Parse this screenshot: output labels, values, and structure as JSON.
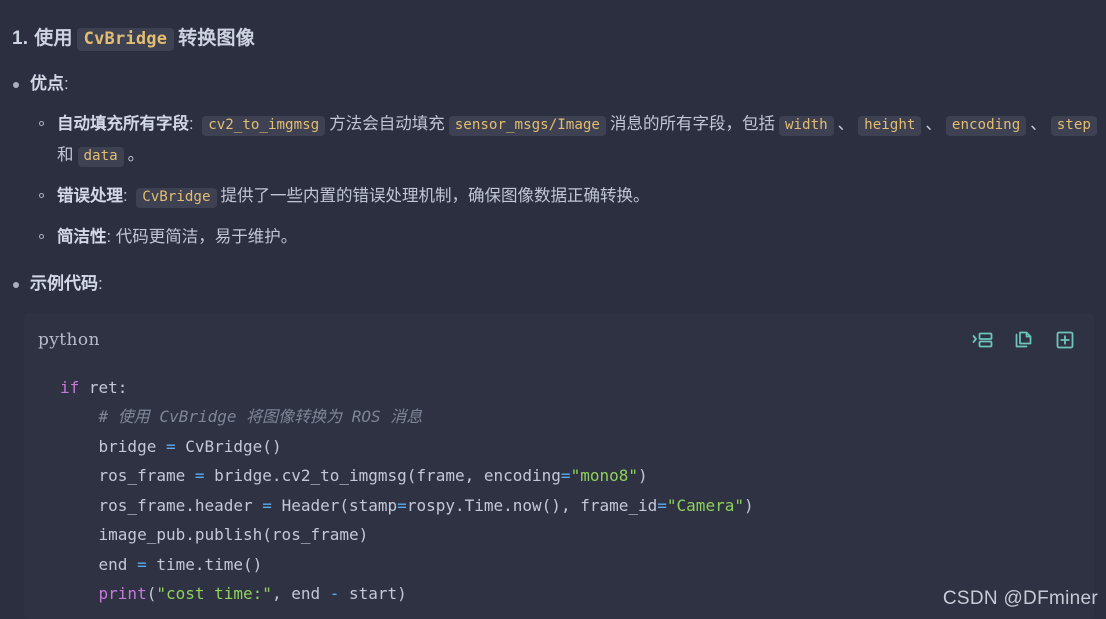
{
  "heading": {
    "number": "1.",
    "text_before": "使用",
    "code": "CvBridge",
    "text_after": "转换图像"
  },
  "sections": [
    {
      "label": "优点",
      "colon": ":",
      "items": [
        {
          "label": "自动填充所有字段",
          "colon": ":",
          "parts": [
            {
              "type": "code",
              "text": "cv2_to_imgmsg"
            },
            {
              "type": "text",
              "text": "方法会自动填充"
            },
            {
              "type": "code",
              "text": "sensor_msgs/Image"
            },
            {
              "type": "text",
              "text": "消息的所有字段，包括"
            },
            {
              "type": "code",
              "text": "width"
            },
            {
              "type": "text",
              "text": "、"
            },
            {
              "type": "code",
              "text": "height"
            },
            {
              "type": "text",
              "text": "、"
            },
            {
              "type": "code",
              "text": "encoding"
            },
            {
              "type": "text",
              "text": "、"
            },
            {
              "type": "code",
              "text": "step"
            },
            {
              "type": "text",
              "text": "和"
            },
            {
              "type": "code",
              "text": "data"
            },
            {
              "type": "text",
              "text": "。"
            }
          ]
        },
        {
          "label": "错误处理",
          "colon": ":",
          "parts": [
            {
              "type": "code",
              "text": "CvBridge"
            },
            {
              "type": "text",
              "text": "提供了一些内置的错误处理机制，确保图像数据正确转换。"
            }
          ]
        },
        {
          "label": "简洁性",
          "colon": ":",
          "parts": [
            {
              "type": "text",
              "text": "代码更简洁，易于维护。"
            }
          ]
        }
      ]
    },
    {
      "label": "示例代码",
      "colon": ":",
      "items": []
    }
  ],
  "codeblock": {
    "language": "python",
    "actions": [
      {
        "name": "run-icon",
        "title": "运行"
      },
      {
        "name": "copy-icon",
        "title": "复制"
      },
      {
        "name": "add-icon",
        "title": "添加"
      }
    ],
    "lines": [
      [
        {
          "cls": "tok-kw",
          "t": "if"
        },
        {
          "cls": "tok-plain",
          "t": " ret:"
        }
      ],
      [
        {
          "cls": "tok-plain",
          "t": "    "
        },
        {
          "cls": "tok-cmt",
          "t": "# 使用 CvBridge 将图像转换为 ROS 消息"
        }
      ],
      [
        {
          "cls": "tok-plain",
          "t": "    bridge "
        },
        {
          "cls": "tok-op",
          "t": "="
        },
        {
          "cls": "tok-plain",
          "t": " CvBridge()"
        }
      ],
      [
        {
          "cls": "tok-plain",
          "t": "    ros_frame "
        },
        {
          "cls": "tok-op",
          "t": "="
        },
        {
          "cls": "tok-plain",
          "t": " bridge.cv2_to_imgmsg(frame, encoding"
        },
        {
          "cls": "tok-op",
          "t": "="
        },
        {
          "cls": "tok-str",
          "t": "\"mono8\""
        },
        {
          "cls": "tok-plain",
          "t": ")"
        }
      ],
      [
        {
          "cls": "tok-plain",
          "t": "    ros_frame.header "
        },
        {
          "cls": "tok-op",
          "t": "="
        },
        {
          "cls": "tok-plain",
          "t": " Header(stamp"
        },
        {
          "cls": "tok-op",
          "t": "="
        },
        {
          "cls": "tok-plain",
          "t": "rospy.Time.now(), frame_id"
        },
        {
          "cls": "tok-op",
          "t": "="
        },
        {
          "cls": "tok-str",
          "t": "\"Camera\""
        },
        {
          "cls": "tok-plain",
          "t": ")"
        }
      ],
      [
        {
          "cls": "tok-plain",
          "t": "    image_pub.publish(ros_frame)"
        }
      ],
      [
        {
          "cls": "tok-plain",
          "t": "    end "
        },
        {
          "cls": "tok-op",
          "t": "="
        },
        {
          "cls": "tok-plain",
          "t": " time.time()"
        }
      ],
      [
        {
          "cls": "tok-plain",
          "t": "    "
        },
        {
          "cls": "tok-fn",
          "t": "print"
        },
        {
          "cls": "tok-plain",
          "t": "("
        },
        {
          "cls": "tok-str",
          "t": "\"cost time:\""
        },
        {
          "cls": "tok-plain",
          "t": ", end "
        },
        {
          "cls": "tok-op",
          "t": "-"
        },
        {
          "cls": "tok-plain",
          "t": " start)"
        }
      ]
    ]
  },
  "watermark": "CSDN @DFminer",
  "colors": {
    "page_bg": "#2c2f40",
    "code_bg": "#2f3242",
    "chip_bg": "#3d4152",
    "chip_fg": "#e3bd72",
    "icon": "#6dc5bd",
    "keyword": "#c678dd",
    "string": "#8fd15c",
    "operator": "#5aacf0",
    "comment": "#7e8599",
    "text": "#c3c8d8"
  }
}
